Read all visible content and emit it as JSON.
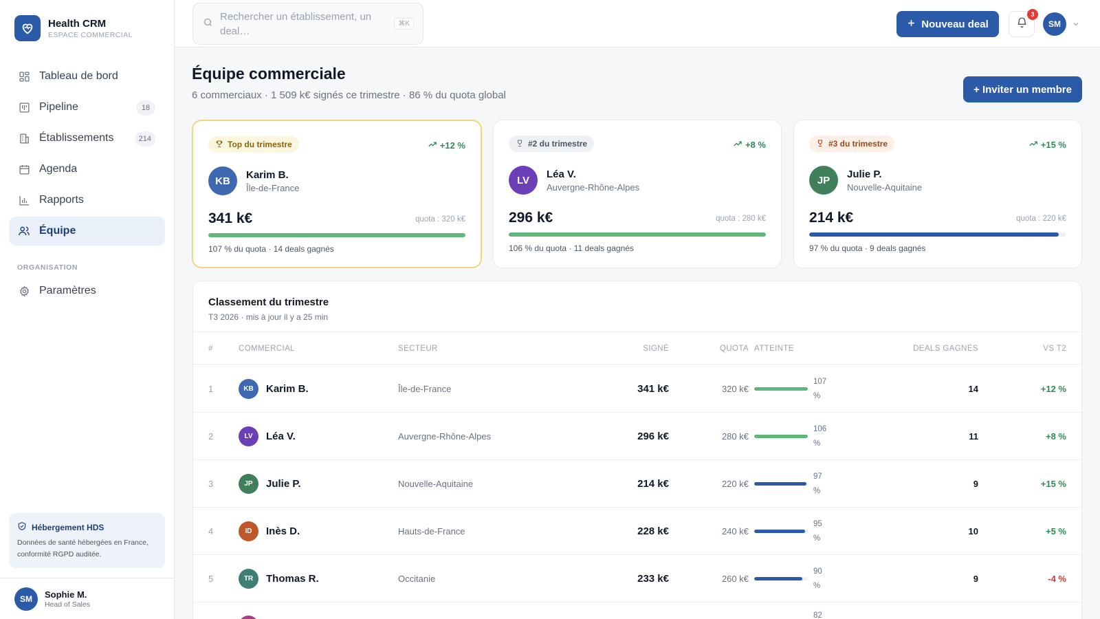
{
  "brand": {
    "name": "Health CRM",
    "subtitle": "ESPACE COMMERCIAL"
  },
  "sidebar": {
    "items": [
      {
        "label": "Tableau de bord",
        "icon": "dashboard-icon",
        "badge": ""
      },
      {
        "label": "Pipeline",
        "icon": "pipeline-icon",
        "badge": "18"
      },
      {
        "label": "Établissements",
        "icon": "building-icon",
        "badge": "214"
      },
      {
        "label": "Agenda",
        "icon": "calendar-icon",
        "badge": ""
      },
      {
        "label": "Rapports",
        "icon": "bar-chart-icon",
        "badge": ""
      },
      {
        "label": "Équipe",
        "icon": "users-icon",
        "badge": "",
        "active": true
      }
    ],
    "section_label": "ORGANISATION",
    "settings_label": "Paramètres",
    "hds": {
      "title": "Hébergement HDS",
      "text": "Données de santé hébergées en France, conformité RGPD auditée."
    },
    "user": {
      "initials": "SM",
      "name": "Sophie M.",
      "role": "Head of Sales"
    }
  },
  "topbar": {
    "search_placeholder": "Rechercher un établissement, un deal…",
    "shortcut": "⌘K",
    "new_deal_label": "Nouveau deal",
    "notifications_count": "3",
    "user_initials": "SM"
  },
  "page": {
    "title": "Équipe commerciale",
    "subtitle": "6 commerciaux · 1 509 k€ signés ce trimestre · 86 % du quota global",
    "invite_label": "+ Inviter un membre"
  },
  "podium": [
    {
      "rank_label": "Top du trimestre",
      "trend": "+12 %",
      "initials": "KB",
      "name": "Karim B.",
      "region": "Île-de-France",
      "signed": "341 k€",
      "quota": "quota : 320 k€",
      "progress": 1.0,
      "footer": "107 % du quota · 14 deals gagnés"
    },
    {
      "rank_label": "#2 du trimestre",
      "trend": "+8 %",
      "initials": "LV",
      "name": "Léa V.",
      "region": "Auvergne-Rhône-Alpes",
      "signed": "296 k€",
      "quota": "quota : 280 k€",
      "progress": 1.0,
      "footer": "106 % du quota · 11 deals gagnés"
    },
    {
      "rank_label": "#3 du trimestre",
      "trend": "+15 %",
      "initials": "JP",
      "name": "Julie P.",
      "region": "Nouvelle-Aquitaine",
      "signed": "214 k€",
      "quota": "quota : 220 k€",
      "progress": 0.97,
      "footer": "97 % du quota · 9 deals gagnés"
    }
  ],
  "ranking": {
    "title": "Classement du trimestre",
    "subtitle": "T3 2026 · mis à jour il y a 25 min",
    "columns": [
      "#",
      "COMMERCIAL",
      "SECTEUR",
      "SIGNÉ",
      "QUOTA",
      "ATTEINTE",
      "DEALS GAGNÉS",
      "VS T2"
    ],
    "rows": [
      {
        "rank": "1",
        "initials": "KB",
        "name": "Karim B.",
        "sector": "Île-de-France",
        "signed": "341 k€",
        "quota": "320 k€",
        "attainment": 107,
        "attainment_label": "107 %",
        "deals": "14",
        "vs": "+12 %"
      },
      {
        "rank": "2",
        "initials": "LV",
        "name": "Léa V.",
        "sector": "Auvergne-Rhône-Alpes",
        "signed": "296 k€",
        "quota": "280 k€",
        "attainment": 106,
        "attainment_label": "106 %",
        "deals": "11",
        "vs": "+8 %"
      },
      {
        "rank": "3",
        "initials": "JP",
        "name": "Julie P.",
        "sector": "Nouvelle-Aquitaine",
        "signed": "214 k€",
        "quota": "220 k€",
        "attainment": 97,
        "attainment_label": "97 %",
        "deals": "9",
        "vs": "+15 %"
      },
      {
        "rank": "4",
        "initials": "ID",
        "name": "Inès D.",
        "sector": "Hauts-de-France",
        "signed": "228 k€",
        "quota": "240 k€",
        "attainment": 95,
        "attainment_label": "95 %",
        "deals": "10",
        "vs": "+5 %"
      },
      {
        "rank": "5",
        "initials": "TR",
        "name": "Thomas R.",
        "sector": "Occitanie",
        "signed": "233 k€",
        "quota": "260 k€",
        "attainment": 90,
        "attainment_label": "90 %",
        "deals": "9",
        "vs": "-4 %"
      }
    ],
    "partial_row_attainment_label": "82"
  },
  "colors": {
    "primary": "#2b5ba8",
    "positive": "#2e8b57",
    "negative": "#d9342b",
    "bar_green": "#5fb87a",
    "bar_blue": "#2b5ba8",
    "avatar_kb": "#3e68b0",
    "avatar_lv": "#6a3fb8",
    "avatar_jp": "#3f7f5a",
    "avatar_id": "#c0572a",
    "avatar_tr": "#3d7f74",
    "avatar_sm": "#2b5ba8"
  }
}
